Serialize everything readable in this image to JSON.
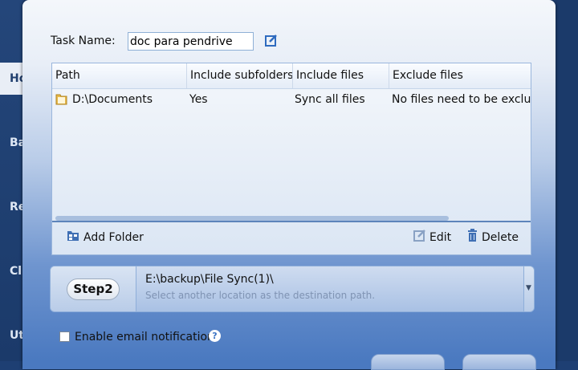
{
  "sidebar": {
    "items": [
      {
        "label": "Ho",
        "active": true
      },
      {
        "label": "Ba",
        "active": false
      },
      {
        "label": "Re",
        "active": false
      },
      {
        "label": "Cl",
        "active": false
      },
      {
        "label": "Ut",
        "active": false
      }
    ]
  },
  "task": {
    "label": "Task Name:",
    "value": "doc para pendrive"
  },
  "table": {
    "headers": [
      "Path",
      "Include subfolders",
      "Include files",
      "Exclude files"
    ],
    "rows": [
      {
        "path": "D:\\Documents",
        "subfolders": "Yes",
        "include": "Sync all files",
        "exclude": "No files need to be exclu"
      }
    ]
  },
  "toolbar": {
    "add_folder": "Add Folder",
    "edit": "Edit",
    "delete": "Delete"
  },
  "step": {
    "label": "Step2",
    "path": "E:\\backup\\File Sync(1)\\",
    "hint": "Select another location as the destination path."
  },
  "email": {
    "label": "Enable email notification",
    "checked": false,
    "help": "?"
  },
  "colors": {
    "accent": "#3b73c4",
    "dialog_bottom": "#4a79c0",
    "background": "#1e3f73"
  }
}
